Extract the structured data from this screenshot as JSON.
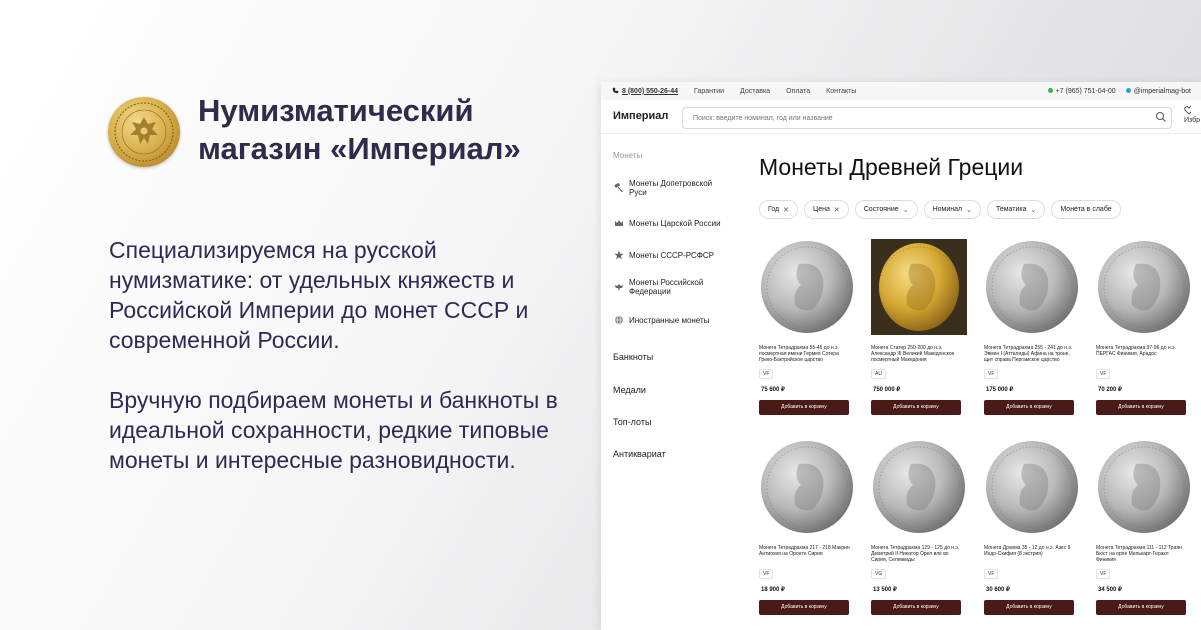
{
  "promo": {
    "title": "Нумизматический магазин «Империал»",
    "paragraph1": "Специализируемся на русской нумизматике: от удельных княжеств и Российской Империи до монет СССР и современной России.",
    "paragraph2": "Вручную подбираем монеты и банкноты в идеальной сохранности, редкие типовые монеты и интересные разновидности."
  },
  "topbar": {
    "phone": "8 (800) 550-26-44",
    "links": [
      "Гарантии",
      "Доставка",
      "Оплата",
      "Контакты"
    ],
    "whatsapp": "+7 (965) 751-04-00",
    "telegram": "@imperialmag-bot"
  },
  "header": {
    "brand": "Империал",
    "search_placeholder": "Поиск: введите номинал, год или название",
    "favorites": "Избр"
  },
  "sidebar": {
    "heading": "Монеты",
    "items": [
      {
        "label": "Монеты Допетровской Руси",
        "icon": "hammer-icon"
      },
      {
        "label": "Монеты Царской России",
        "icon": "crown-icon"
      },
      {
        "label": "Монеты СССР-РСФСР",
        "icon": "star-icon"
      },
      {
        "label": "Монеты Российской Федерации",
        "icon": "eagle-icon"
      },
      {
        "label": "Иностранные монеты",
        "icon": "globe-icon"
      }
    ],
    "sections": [
      "Банкноты",
      "Медали",
      "Топ-лоты",
      "Антиквариат"
    ]
  },
  "page_title": "Монеты Древней Греции",
  "filters": [
    {
      "label": "Год",
      "removable": true
    },
    {
      "label": "Цена",
      "removable": true
    },
    {
      "label": "Состояние",
      "dropdown": true
    },
    {
      "label": "Номинал",
      "dropdown": true
    },
    {
      "label": "Тематика",
      "dropdown": true
    },
    {
      "label": "Монета в слабе"
    }
  ],
  "products": [
    {
      "name": "Монета Тетрадрахма 55-45 до н.э. посмертная имени Гермея Сотера Греко-Бактрийское царство",
      "grade": "VF",
      "price": "75 600 ₽",
      "button": "Добавить в корзину",
      "metal": "silver"
    },
    {
      "name": "Монета Статер 250-200 до н.э. Александр III Великий Македонское посмертный Македония",
      "grade": "AU",
      "price": "750 000 ₽",
      "button": "Добавить в корзину",
      "metal": "gold"
    },
    {
      "name": "Монета Тетрадрахма 255 - 241 до н.э. Эвмен I (Атталиды) Афина на троне, щит справа Пергамское царство",
      "grade": "VF",
      "price": "175 000 ₽",
      "button": "Добавить в корзину",
      "metal": "silver"
    },
    {
      "name": "Монета Тетрадрахма 97-96 до н.э. ПЕРГАС Финикия, Арадос",
      "grade": "VF",
      "price": "70 200 ₽",
      "button": "Добавить в корзину",
      "metal": "silver"
    },
    {
      "name": "Монета Тетрадрахма 217 - 218 Макрин Антиохия на Оронте Сирия",
      "grade": "VF",
      "price": "18 900 ₽",
      "button": "Добавить в корзину",
      "metal": "silver"
    },
    {
      "name": "Монета Тетрадрахма 129 - 125 до н.э. Деметрий II Никатор Орел вле во Сирия, Селевкиды",
      "grade": "VG",
      "price": "13 500 ₽",
      "button": "Добавить в корзину",
      "metal": "silver"
    },
    {
      "name": "Монета Драхма 35 - 12 до н.э. Азес II Индо-Скифия (8 экстрия)",
      "grade": "VF",
      "price": "30 600 ₽",
      "button": "Добавить в корзину",
      "metal": "silver"
    },
    {
      "name": "Монета Тетрадрахма 111 - 112 Траян Бюст на орле Мелькарт-Геракл Финикия",
      "grade": "VF",
      "price": "34 500 ₽",
      "button": "Добавить в корзину",
      "metal": "silver"
    }
  ]
}
